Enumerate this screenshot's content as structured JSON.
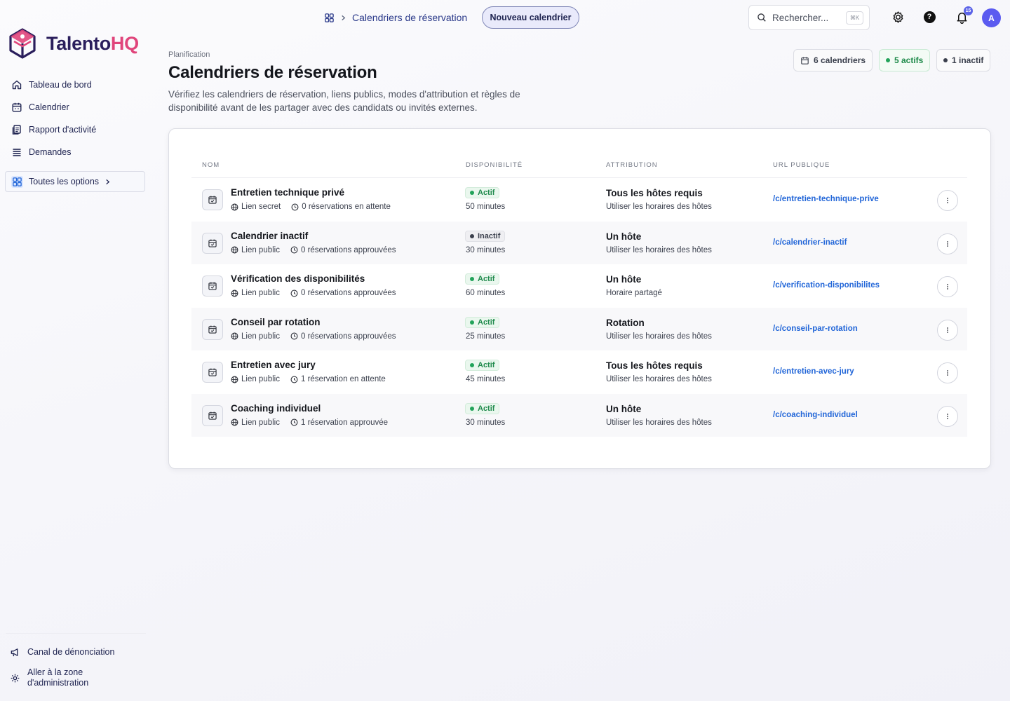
{
  "brand": {
    "name_part1": "Talento",
    "name_part2": "HQ",
    "accent": "#e0457b",
    "primary": "#2a1e5c"
  },
  "sidebar": {
    "items": [
      {
        "label": "Tableau de bord",
        "icon": "home-icon"
      },
      {
        "label": "Calendrier",
        "icon": "calendar-icon"
      },
      {
        "label": "Rapport d'activité",
        "icon": "report-icon"
      },
      {
        "label": "Demandes",
        "icon": "list-icon"
      }
    ],
    "all_options": "Toutes les options",
    "bottom": {
      "whistle": "Canal de dénonciation",
      "admin": "Aller à la zone d'administration"
    }
  },
  "topbar": {
    "breadcrumb": "Calendriers de réservation",
    "new_button": "Nouveau calendrier",
    "search_placeholder": "Rechercher...",
    "search_shortcut": "⌘K",
    "notif_count": "15",
    "avatar_initial": "A"
  },
  "header": {
    "eyebrow": "Planification",
    "title": "Calendriers de réservation",
    "description": "Vérifiez les calendriers de réservation, liens publics, modes d'attribution et règles de disponibilité avant de les partager avec des candidats ou invités externes.",
    "stats": {
      "total": "6 calendriers",
      "active": "5 actifs",
      "inactive": "1 inactif"
    }
  },
  "table": {
    "columns": [
      "NOM",
      "DISPONIBILITÉ",
      "ATTRIBUTION",
      "URL PUBLIQUE"
    ],
    "rows": [
      {
        "name": "Entretien technique privé",
        "link": "Lien secret",
        "bookings": "0 réservations en attente",
        "status": "Actif",
        "active": true,
        "duration": "50 minutes",
        "attribution": "Tous les hôtes requis",
        "schedule": "Utiliser les horaires des hôtes",
        "url": "/c/entretien-technique-prive"
      },
      {
        "name": "Calendrier inactif",
        "link": "Lien public",
        "bookings": "0 réservations approuvées",
        "status": "Inactif",
        "active": false,
        "duration": "30 minutes",
        "attribution": "Un hôte",
        "schedule": "Utiliser les horaires des hôtes",
        "url": "/c/calendrier-inactif"
      },
      {
        "name": "Vérification des disponibilités",
        "link": "Lien public",
        "bookings": "0 réservations approuvées",
        "status": "Actif",
        "active": true,
        "duration": "60 minutes",
        "attribution": "Un hôte",
        "schedule": "Horaire partagé",
        "url": "/c/verification-disponibilites"
      },
      {
        "name": "Conseil par rotation",
        "link": "Lien public",
        "bookings": "0 réservations approuvées",
        "status": "Actif",
        "active": true,
        "duration": "25 minutes",
        "attribution": "Rotation",
        "schedule": "Utiliser les horaires des hôtes",
        "url": "/c/conseil-par-rotation"
      },
      {
        "name": "Entretien avec jury",
        "link": "Lien public",
        "bookings": "1 réservation en attente",
        "status": "Actif",
        "active": true,
        "duration": "45 minutes",
        "attribution": "Tous les hôtes requis",
        "schedule": "Utiliser les horaires des hôtes",
        "url": "/c/entretien-avec-jury"
      },
      {
        "name": "Coaching individuel",
        "link": "Lien public",
        "bookings": "1 réservation approuvée",
        "status": "Actif",
        "active": true,
        "duration": "30 minutes",
        "attribution": "Un hôte",
        "schedule": "Utiliser les horaires des hôtes",
        "url": "/c/coaching-individuel"
      }
    ]
  }
}
